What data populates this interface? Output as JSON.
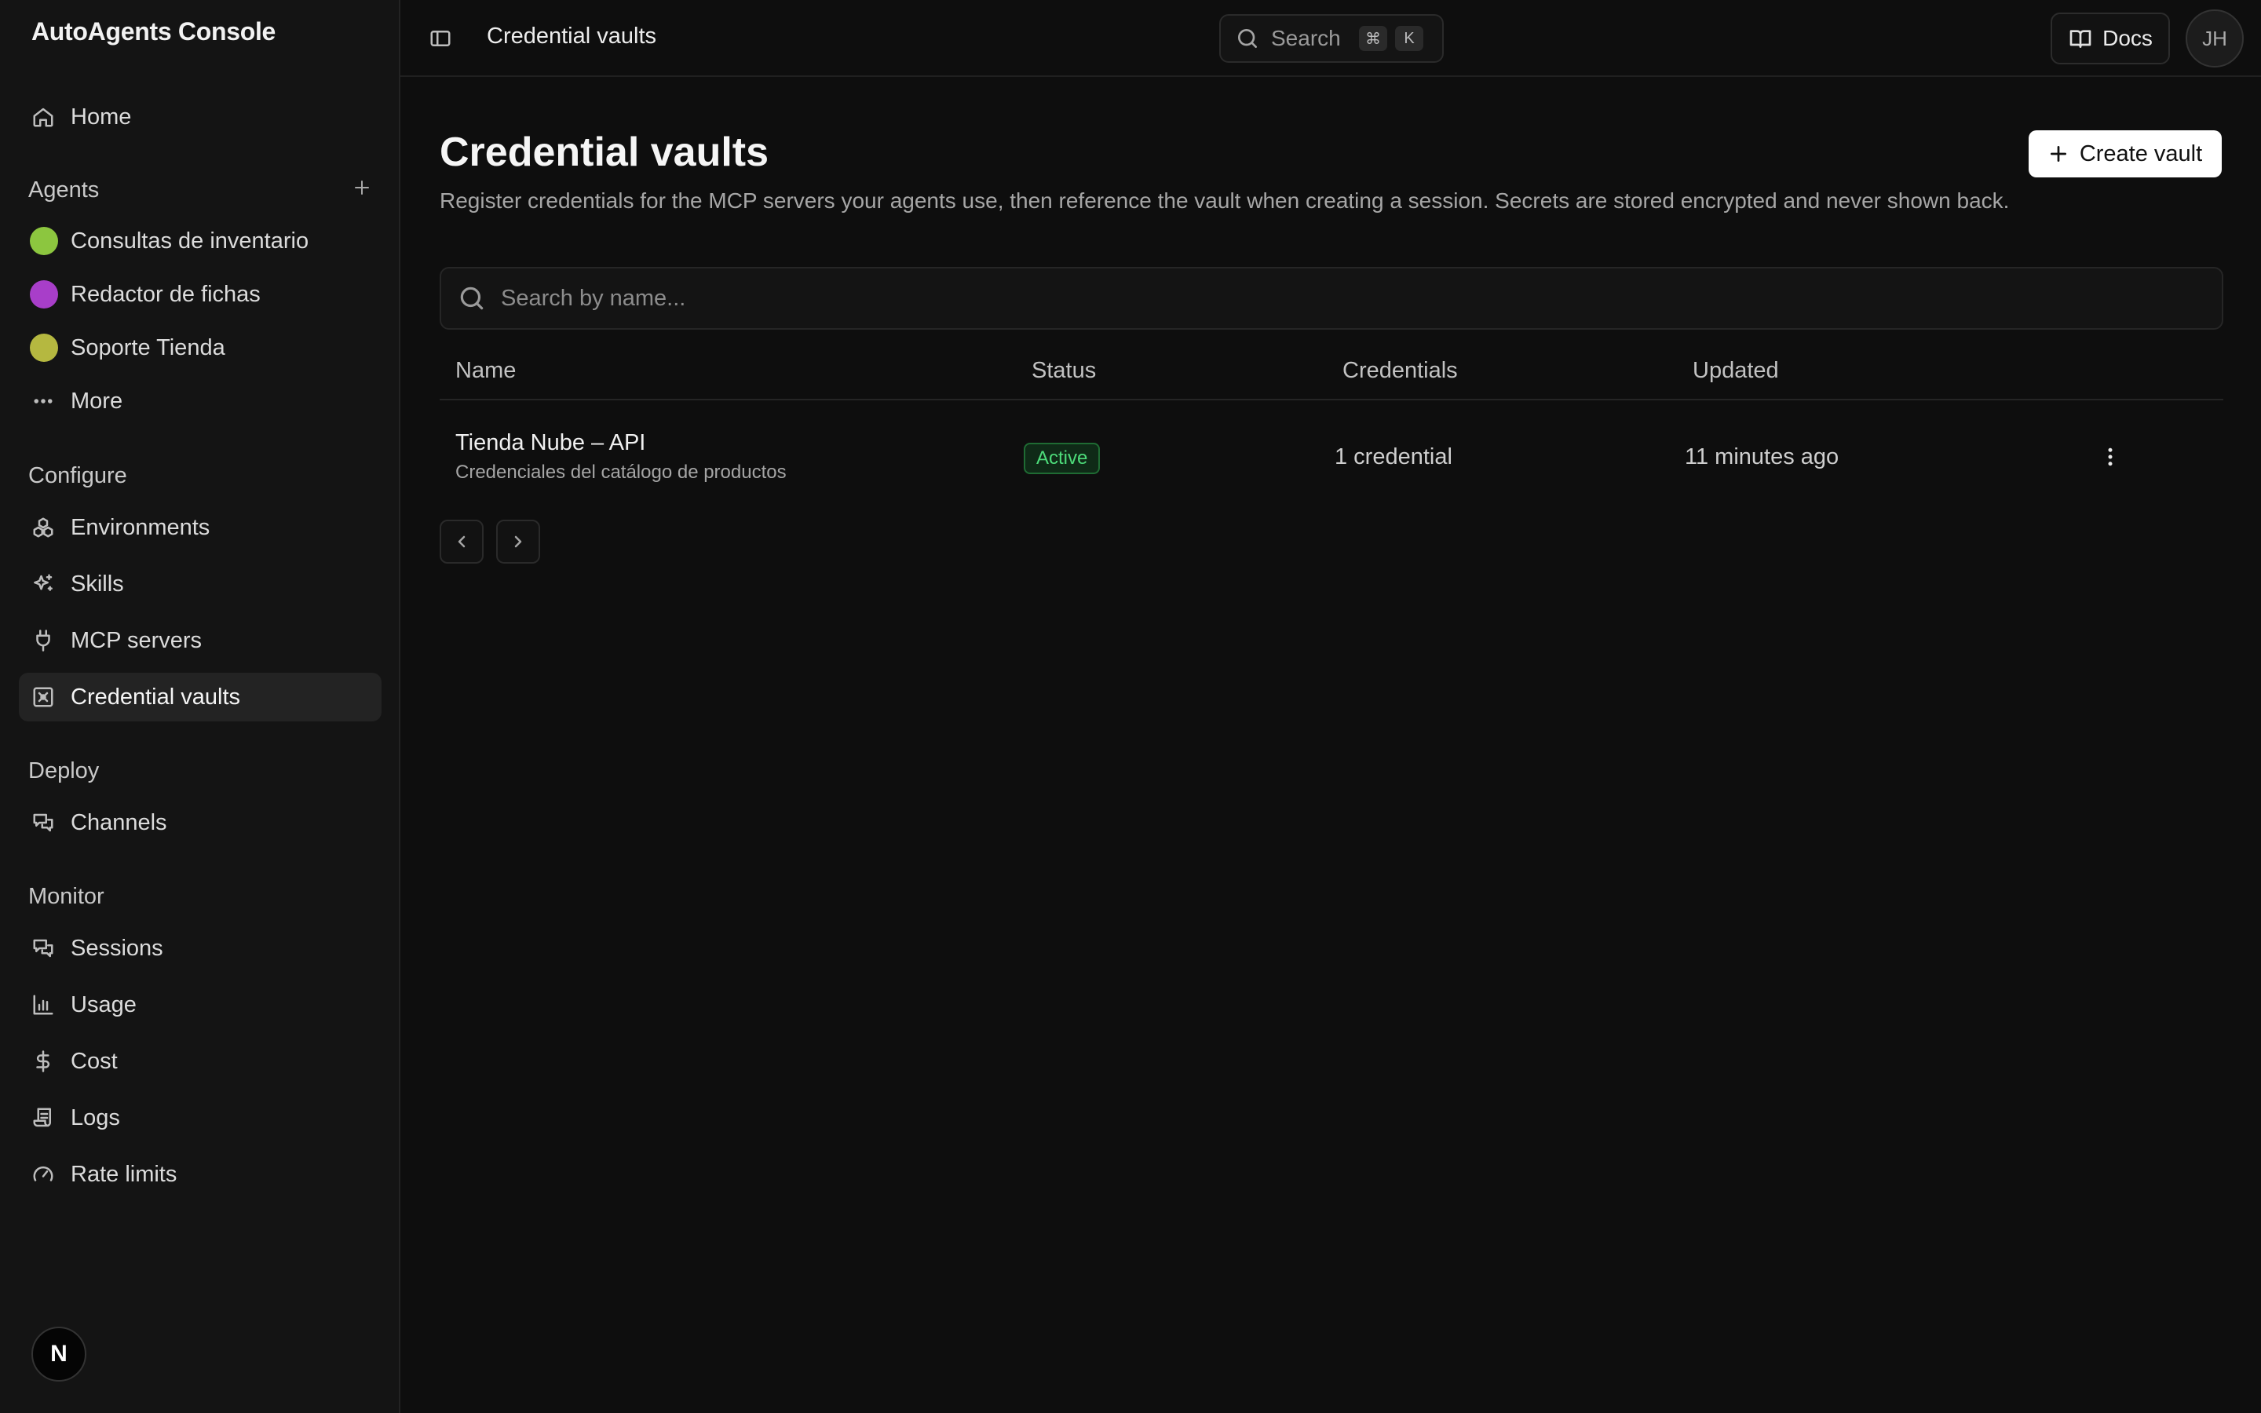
{
  "app": {
    "title": "AutoAgents Console"
  },
  "sidebar": {
    "home": "Home",
    "agents_section": "Agents",
    "agents": [
      {
        "label": "Consultas de inventario",
        "color": "#8cc63f"
      },
      {
        "label": "Redactor de fichas",
        "color": "#a83ec9"
      },
      {
        "label": "Soporte Tienda",
        "color": "#b5b840"
      }
    ],
    "more": "More",
    "configure_section": "Configure",
    "configure": [
      "Environments",
      "Skills",
      "MCP servers",
      "Credential vaults"
    ],
    "deploy_section": "Deploy",
    "deploy": [
      "Channels"
    ],
    "monitor_section": "Monitor",
    "monitor": [
      "Sessions",
      "Usage",
      "Cost",
      "Logs",
      "Rate limits"
    ],
    "active_item": "Credential vaults",
    "bottom_badge": "N"
  },
  "topbar": {
    "breadcrumb": "Credential vaults",
    "search_placeholder": "Search",
    "shortcut": [
      "⌘",
      "K"
    ],
    "docs": "Docs",
    "user_initials": "JH"
  },
  "page": {
    "title": "Credential vaults",
    "description": "Register credentials for the MCP servers your agents use, then reference the vault when creating a session. Secrets are stored encrypted and never shown back.",
    "create_button": "Create vault",
    "search_placeholder": "Search by name..."
  },
  "table": {
    "headers": [
      "Name",
      "Status",
      "Credentials",
      "Updated"
    ],
    "rows": [
      {
        "name": "Tienda Nube – API",
        "description": "Credenciales del catálogo de productos",
        "status": "Active",
        "credentials": "1 credential",
        "updated": "11 minutes ago"
      }
    ]
  },
  "colors": {
    "accent_active": "#4ddc7a",
    "background": "#0e0e0e",
    "sidebar": "#141414"
  }
}
